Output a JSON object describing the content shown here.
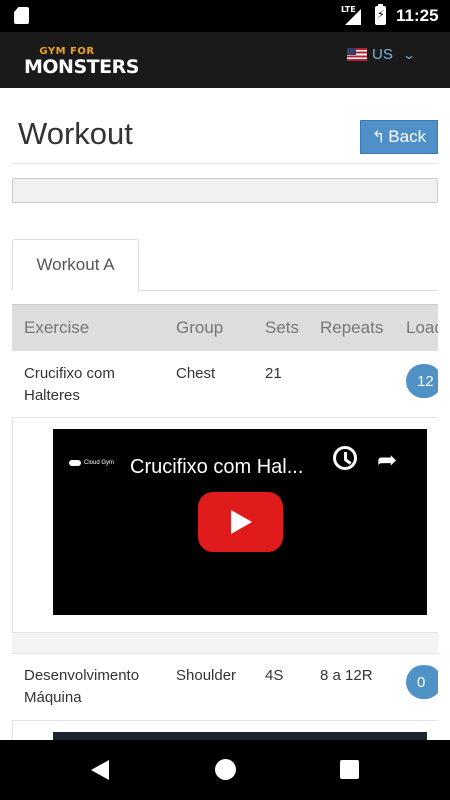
{
  "status_bar": {
    "time": "11:25",
    "network": "LTE"
  },
  "header": {
    "logo_top": "GYM FOR",
    "logo_main": "MONSTERS",
    "language": "US",
    "flag_icon": "us-flag-icon"
  },
  "page": {
    "title": "Workout",
    "back_label": "Back"
  },
  "tabs": [
    {
      "label": "Workout A",
      "active": true
    }
  ],
  "table": {
    "headers": [
      "Exercise",
      "Group",
      "Sets",
      "Repeats",
      "Load"
    ],
    "rows": [
      {
        "exercise_line1": "Crucifixo com",
        "exercise_line2": "Halteres",
        "group": "Chest",
        "sets": "21",
        "repeats": "",
        "load": "12",
        "video": {
          "title": "Crucifixo com Hal...",
          "channel": "Cloud Gym"
        }
      },
      {
        "exercise_line1": "Desenvolvimento",
        "exercise_line2": "Máquina",
        "group": "Shoulder",
        "sets": "4S",
        "repeats": "8 a 12R",
        "load": "0"
      }
    ]
  },
  "colors": {
    "accent": "#5090c8",
    "youtube_red": "#e01b1b",
    "header_bg": "#1a1a1a"
  }
}
